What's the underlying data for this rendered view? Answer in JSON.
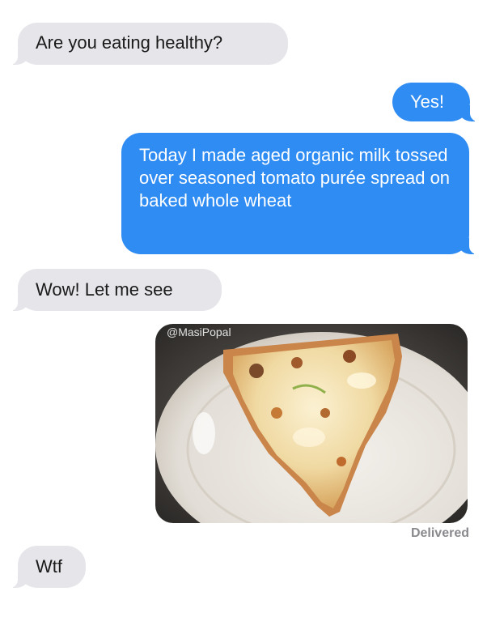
{
  "conversation": {
    "messages": [
      {
        "direction": "received",
        "text": "Are you eating healthy?"
      },
      {
        "direction": "sent",
        "text": "Yes!"
      },
      {
        "direction": "sent",
        "text": "Today I made aged organic milk tossed over seasoned tomato purée spread on baked whole wheat"
      },
      {
        "direction": "received",
        "text": "Wow! Let me see"
      },
      {
        "direction": "received",
        "text": "Wtf"
      }
    ],
    "photo": {
      "icon": "pizza-slice-photo",
      "watermark": "@MasiPopal"
    },
    "status": "Delivered"
  },
  "colors": {
    "sent_bubble": "#2f8cf3",
    "received_bubble": "#e6e5ea",
    "status_text": "#8a8a8e"
  }
}
